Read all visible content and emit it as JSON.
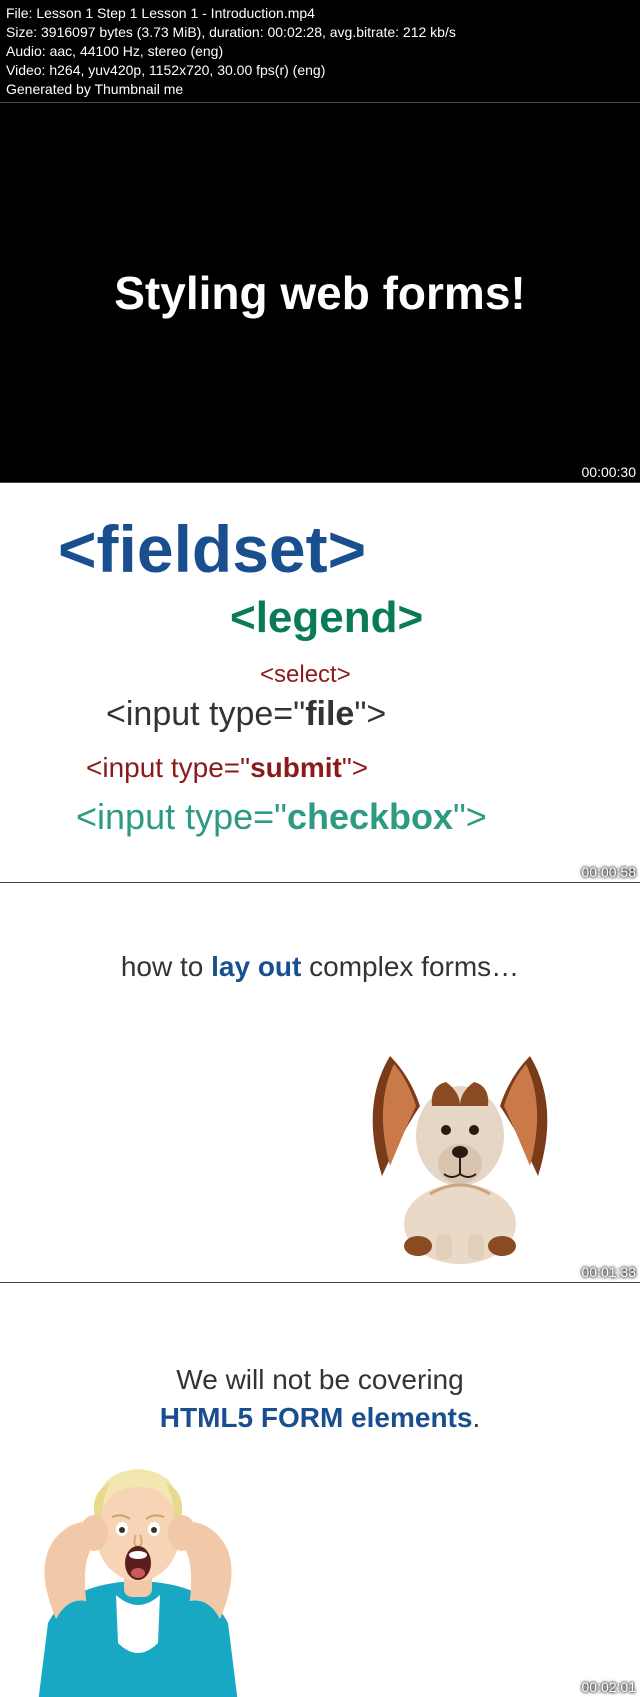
{
  "meta": {
    "line1": "File: Lesson 1 Step 1 Lesson 1 - Introduction.mp4",
    "line2": "Size: 3916097 bytes (3.73 MiB), duration: 00:02:28, avg.bitrate: 212 kb/s",
    "line3": "Audio: aac, 44100 Hz, stereo (eng)",
    "line4": "Video: h264, yuv420p, 1152x720, 30.00 fps(r) (eng)",
    "line5": "Generated by Thumbnail me"
  },
  "frame1": {
    "title": "Styling web forms!",
    "timestamp": "00:00:30"
  },
  "frame2": {
    "fieldset": "<fieldset>",
    "legend": "<legend>",
    "select": "<select>",
    "file_pre": "<input type=\"",
    "file_b": "file",
    "file_post": "\">",
    "submit_pre": "<input type=\"",
    "submit_b": "submit",
    "submit_post": "\">",
    "checkbox_pre": "<input type=\"",
    "checkbox_b": "checkbox",
    "checkbox_post": "\">",
    "timestamp": "00:00:58"
  },
  "frame3": {
    "caption_pre": "how to ",
    "caption_emph": "lay out",
    "caption_post": " complex forms…",
    "timestamp": "00:01:33"
  },
  "frame4": {
    "line1": "We will not be covering",
    "line2_emph": "HTML5 FORM elements",
    "line2_post": ".",
    "timestamp": "00:02:01"
  }
}
